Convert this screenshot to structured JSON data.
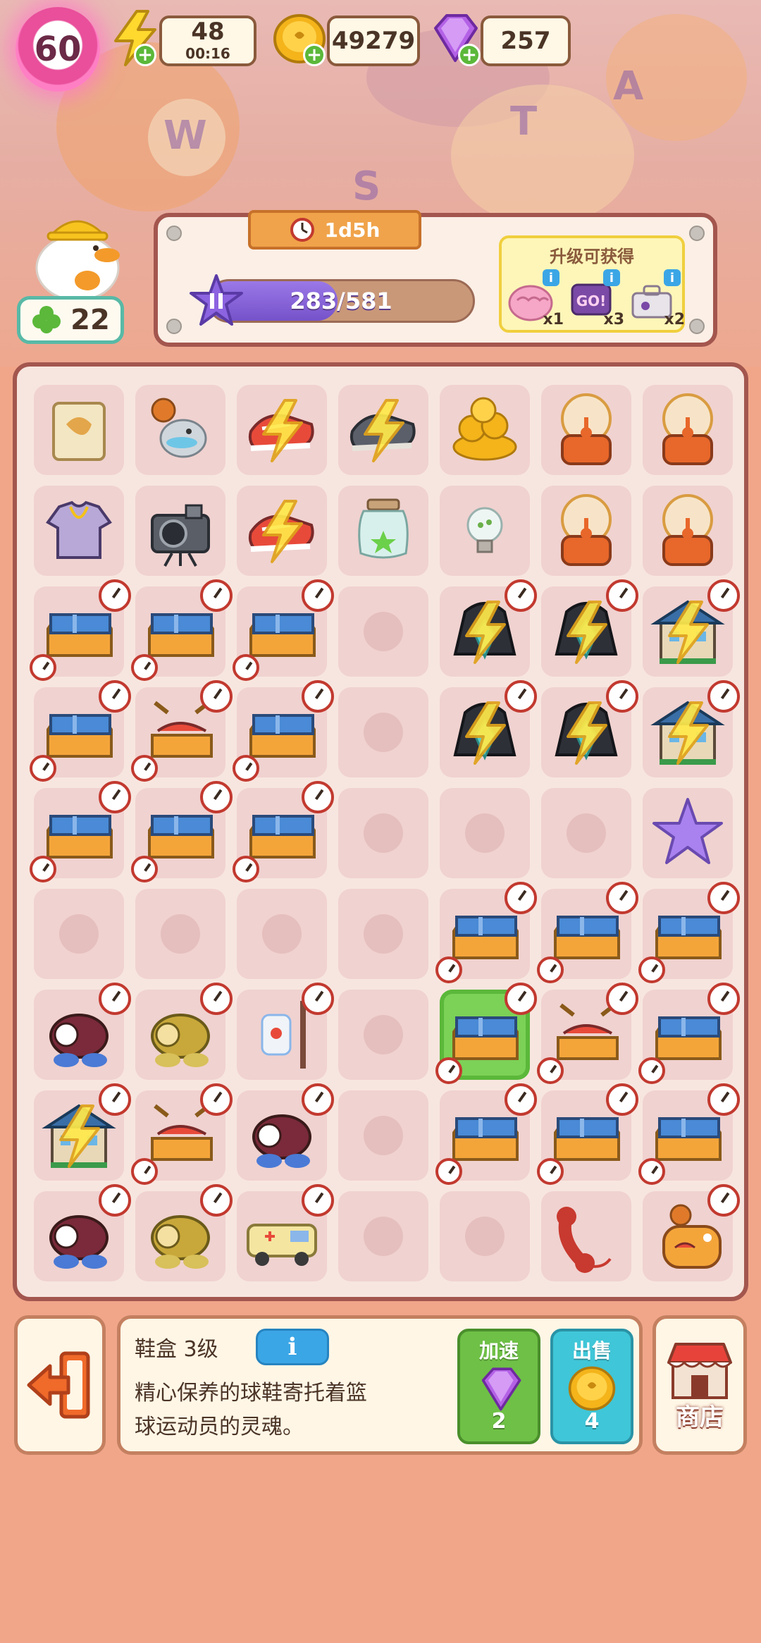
{
  "header": {
    "level": "60",
    "energy": {
      "value": "48",
      "timer": "00:16",
      "icon": "lightning-icon"
    },
    "coins": {
      "value": "49279",
      "icon": "coin-icon"
    },
    "gems": {
      "value": "257",
      "icon": "gem-icon"
    }
  },
  "workers": {
    "count": "22"
  },
  "order": {
    "timer": "1d5h",
    "progress": {
      "current": 283,
      "max": 581,
      "label": "283/581"
    },
    "rewards_title": "升级可获得",
    "rewards": [
      {
        "icon": "brain-icon",
        "qty": "x1"
      },
      {
        "icon": "go-sign-icon",
        "qty": "x3"
      },
      {
        "icon": "toolbox-icon",
        "qty": "x2"
      }
    ]
  },
  "board": {
    "columns": 7,
    "rows": 9,
    "selected_cell": [
      6,
      4
    ],
    "cells": [
      [
        "cardboard-box",
        "ball-fish",
        "sneakers",
        "gray-sneakers",
        "coin-pile",
        "gumball-machine",
        "gumball-machine"
      ],
      [
        "tshirt",
        "camera",
        "sneakers",
        "potion-jar",
        "lightbulb",
        "gumball-machine",
        "gumball-machine"
      ],
      [
        "shoebox",
        "shoebox",
        "shoebox",
        "",
        "hoodie",
        "hoodie",
        "building"
      ],
      [
        "shoebox",
        "open-shoebox",
        "shoebox",
        "",
        "hoodie",
        "hoodie",
        "building"
      ],
      [
        "shoebox",
        "shoebox",
        "shoebox",
        "",
        "",
        "",
        "star"
      ],
      [
        "",
        "",
        "",
        "",
        "shoebox",
        "shoebox",
        "shoebox"
      ],
      [
        "sitting-figure",
        "gold-figure",
        "iv-bag",
        "",
        "shoebox",
        "open-shoebox",
        "shoebox"
      ],
      [
        "building",
        "open-shoebox",
        "sitting-figure",
        "",
        "shoebox",
        "shoebox",
        "shoebox"
      ],
      [
        "sitting-figure",
        "gold-figure",
        "ambulance",
        "",
        "",
        "telephone",
        "snail-bot"
      ]
    ]
  },
  "info": {
    "title": "鞋盒 3级",
    "info_label": "i",
    "description_line1": "精心保养的球鞋寄托着篮",
    "description_line2": "球运动员的灵魂。",
    "speedup": {
      "label": "加速",
      "amount": "2",
      "icon": "gem-icon"
    },
    "sell": {
      "label": "出售",
      "amount": "4",
      "icon": "coin-icon"
    },
    "shop": {
      "label": "商店",
      "icon": "shop-icon"
    },
    "exit_icon": "exit-icon"
  },
  "colors": {
    "background": "#f1a68a",
    "board_border": "#a3564e",
    "xp_fill": "#7552c9",
    "speedup": "#6ec046",
    "sell": "#3fc6d8"
  }
}
